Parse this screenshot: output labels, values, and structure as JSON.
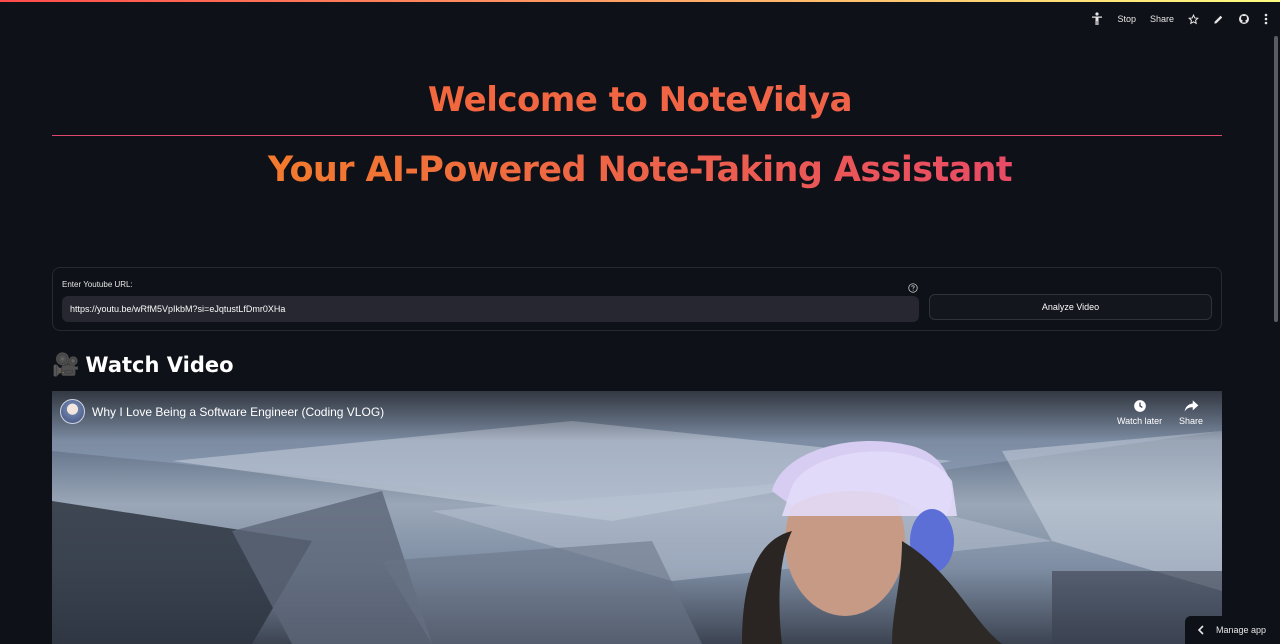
{
  "toolbar": {
    "accessibility_icon": "accessibility-icon",
    "stop_label": "Stop",
    "share_label": "Share",
    "icons": [
      "star-icon",
      "pencil-icon",
      "github-icon",
      "more-vertical-icon"
    ]
  },
  "header": {
    "title": "Welcome to NoteVidya",
    "subtitle": "Your AI-Powered Note-Taking Assistant"
  },
  "form": {
    "url_label": "Enter Youtube URL:",
    "url_value": "https://youtu.be/wRfM5VpIkbM?si=eJqtustLfDmr0XHa",
    "help_icon": "help-circle-icon",
    "analyze_button_label": "Analyze Video"
  },
  "video_section": {
    "heading_emoji": "🎥",
    "heading": "Watch Video",
    "video_title": "Why I Love Being a Software Engineer (Coding VLOG)",
    "watch_later_label": "Watch later",
    "share_label": "Share"
  },
  "footer": {
    "manage_app_label": "Manage app"
  },
  "colors": {
    "background": "#0e1117",
    "title_gradient_start": "#f36c32",
    "title_gradient_end": "#e84a66",
    "rule": "#e0466e",
    "input_bg": "#262730"
  }
}
